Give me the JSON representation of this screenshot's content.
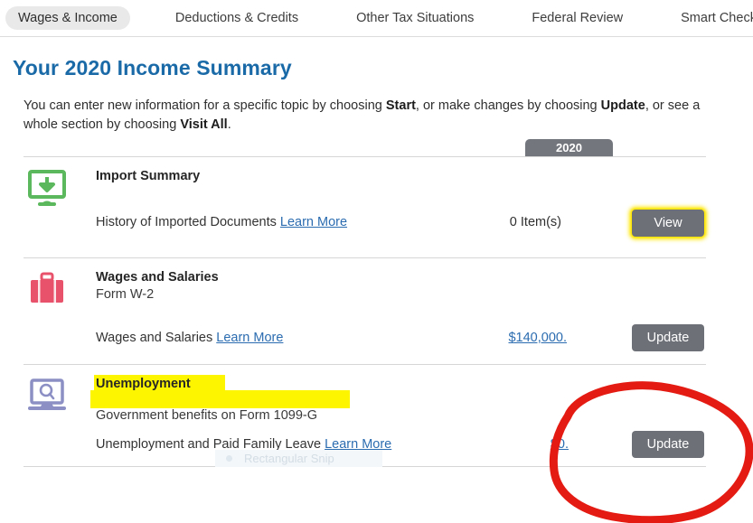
{
  "tabs": [
    {
      "label": "Wages & Income",
      "active": true
    },
    {
      "label": "Deductions & Credits",
      "active": false
    },
    {
      "label": "Other Tax Situations",
      "active": false
    },
    {
      "label": "Federal Review",
      "active": false
    },
    {
      "label": "Smart Check",
      "active": false
    }
  ],
  "page": {
    "title": "Your 2020 Income Summary",
    "intro_part1": "You can enter new information for a specific topic by choosing ",
    "intro_bold1": "Start",
    "intro_part2": ", or make changes by choosing ",
    "intro_bold2": "Update",
    "intro_part3": ", or see a whole section by choosing ",
    "intro_bold3": "Visit All",
    "intro_part4": ".",
    "year_column": "2020"
  },
  "sections": [
    {
      "icon": "monitor-download-icon",
      "icon_color": "#5cb85c",
      "title": "Import Summary",
      "subtitle": "",
      "detail": "History of Imported Documents",
      "learn_more": "Learn More",
      "value": "0 Item(s)",
      "button": "View",
      "highlighted_button": true
    },
    {
      "icon": "briefcase-icon",
      "icon_color": "#e8526a",
      "title": "Wages and Salaries",
      "subtitle": "Form W-2",
      "detail": "Wages and Salaries",
      "learn_more": "Learn More",
      "value": "$140,000.",
      "button": "Update",
      "highlighted_button": false
    },
    {
      "icon": "laptop-search-icon",
      "icon_color": "#8b8fc4",
      "title": "Unemployment",
      "subtitle": "Government benefits on Form 1099-G",
      "detail": "Unemployment and Paid Family Leave",
      "learn_more": "Learn More",
      "value": "$0.",
      "button": "Update",
      "highlighted_button": false
    }
  ],
  "overlays": {
    "snip_tooltip": "Rectangular Snip",
    "highlighter_color": "#fdf500",
    "annotation_color": "#e31b12",
    "annotation_shape": "hand-drawn-red-oval"
  }
}
